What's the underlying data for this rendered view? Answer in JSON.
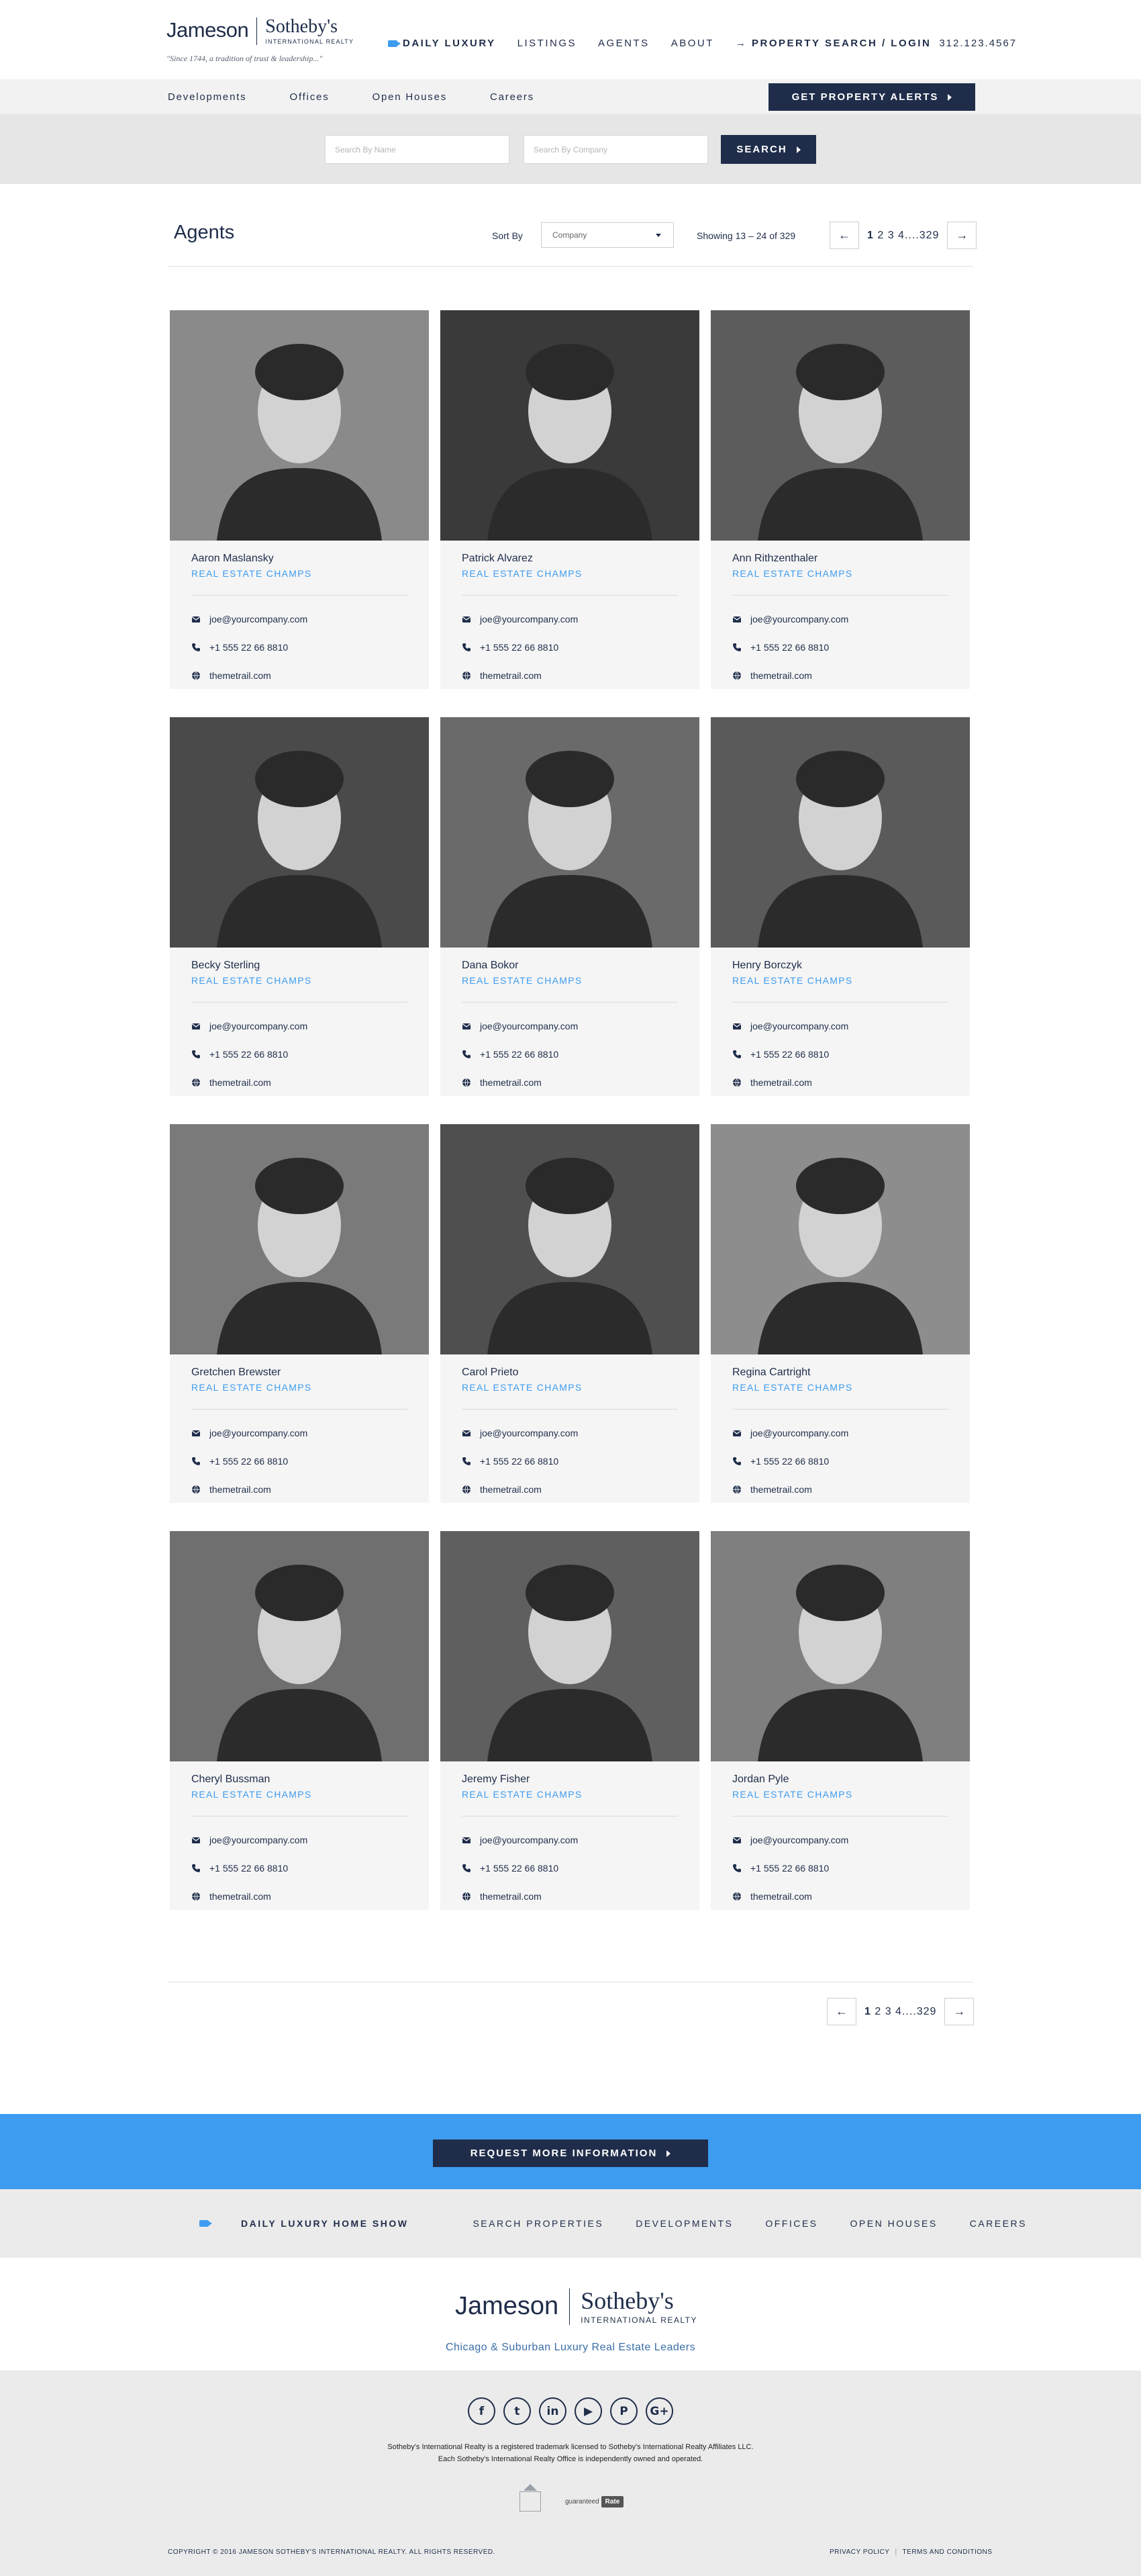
{
  "header": {
    "logo_left": "Jameson",
    "logo_right": "Sotheby's",
    "logo_sub": "INTERNATIONAL REALTY",
    "tagline": "\"Since 1744, a tradition of trust & leadership...\"",
    "nav": {
      "daily_luxury": "DAILY LUXURY",
      "listings": "LISTINGS",
      "agents": "AGENTS",
      "about": "ABOUT",
      "property_search": "PROPERTY SEARCH / LOGIN",
      "phone": "312.123.4567"
    }
  },
  "subnav": {
    "links": [
      "Developments",
      "Offices",
      "Open Houses",
      "Careers"
    ],
    "alert_button": "GET PROPERTY ALERTS"
  },
  "search": {
    "name_placeholder": "Search By Name",
    "company_placeholder": "Search By Company",
    "button": "SEARCH"
  },
  "agents_header": {
    "title": "Agents",
    "sort_label": "Sort By",
    "sort_value": "Company",
    "showing": "Showing 13 – 24 of 329"
  },
  "pagination": {
    "prev": "←",
    "current": "1",
    "pages": " 2  3  4....329",
    "next": "→"
  },
  "agents": [
    {
      "name": "Aaron Maslansky",
      "role": "REAL ESTATE CHAMPS",
      "email": "joe@yourcompany.com",
      "phone": "+1 555 22 66 8810",
      "website": "themetrail.com"
    },
    {
      "name": "Patrick Alvarez",
      "role": "REAL ESTATE CHAMPS",
      "email": "joe@yourcompany.com",
      "phone": "+1 555 22 66 8810",
      "website": "themetrail.com"
    },
    {
      "name": "Ann Rithzenthaler",
      "role": "REAL ESTATE CHAMPS",
      "email": "joe@yourcompany.com",
      "phone": "+1 555 22 66 8810",
      "website": "themetrail.com"
    },
    {
      "name": "Becky Sterling",
      "role": "REAL ESTATE CHAMPS",
      "email": "joe@yourcompany.com",
      "phone": "+1 555 22 66 8810",
      "website": "themetrail.com"
    },
    {
      "name": "Dana Bokor",
      "role": "REAL ESTATE CHAMPS",
      "email": "joe@yourcompany.com",
      "phone": "+1 555 22 66 8810",
      "website": "themetrail.com"
    },
    {
      "name": "Henry Borczyk",
      "role": "REAL ESTATE CHAMPS",
      "email": "joe@yourcompany.com",
      "phone": "+1 555 22 66 8810",
      "website": "themetrail.com"
    },
    {
      "name": "Gretchen Brewster",
      "role": "REAL ESTATE CHAMPS",
      "email": "joe@yourcompany.com",
      "phone": "+1 555 22 66 8810",
      "website": "themetrail.com"
    },
    {
      "name": "Carol Prieto",
      "role": "REAL ESTATE CHAMPS",
      "email": "joe@yourcompany.com",
      "phone": "+1 555 22 66 8810",
      "website": "themetrail.com"
    },
    {
      "name": "Regina Cartright",
      "role": "REAL ESTATE CHAMPS",
      "email": "joe@yourcompany.com",
      "phone": "+1 555 22 66 8810",
      "website": "themetrail.com"
    },
    {
      "name": "Cheryl Bussman",
      "role": "REAL ESTATE CHAMPS",
      "email": "joe@yourcompany.com",
      "phone": "+1 555 22 66 8810",
      "website": "themetrail.com"
    },
    {
      "name": "Jeremy Fisher",
      "role": "REAL ESTATE CHAMPS",
      "email": "joe@yourcompany.com",
      "phone": "+1 555 22 66 8810",
      "website": "themetrail.com"
    },
    {
      "name": "Jordan Pyle",
      "role": "REAL ESTATE CHAMPS",
      "email": "joe@yourcompany.com",
      "phone": "+1 555 22 66 8810",
      "website": "themetrail.com"
    }
  ],
  "footer": {
    "cta": "REQUEST MORE INFORMATION",
    "nav": {
      "daily_show": "DAILY LUXURY HOME SHOW",
      "search": "SEARCH PROPERTIES",
      "developments": "DEVELOPMENTS",
      "offices": "OFFICES",
      "open_houses": "OPEN HOUSES",
      "careers": "CAREERS"
    },
    "logo_left": "Jameson",
    "logo_right": "Sotheby's",
    "logo_sub": "INTERNATIONAL REALTY",
    "leaders": "Chicago & Suburban Luxury Real Estate Leaders",
    "social": [
      "f",
      "t",
      "in",
      "▶",
      "P",
      "G+"
    ],
    "social_icons": [
      "facebook-icon",
      "twitter-icon",
      "linkedin-icon",
      "youtube-icon",
      "pinterest-icon",
      "google-plus-icon"
    ],
    "legal_1": "Sotheby's International Realty is a registered trademark licensed to Sotheby's International Realty Affiliates LLC.",
    "legal_2": "Each Sotheby's International Realty Office is independently owned and operated.",
    "guaranteed": "guaranteed",
    "rate": "Rate",
    "copyright": "COPYRIGHT © 2016 JAMESON SOTHEBY'S INTERNATIONAL REALTY. ALL RIGHTS RESERVED.",
    "privacy": "PRIVACY POLICY",
    "terms": "TERMS AND CONDITIONS"
  },
  "colors": {
    "navy": "#1f2d4a",
    "accent_blue": "#3d9cf0",
    "card_bg": "#f5f5f5"
  }
}
